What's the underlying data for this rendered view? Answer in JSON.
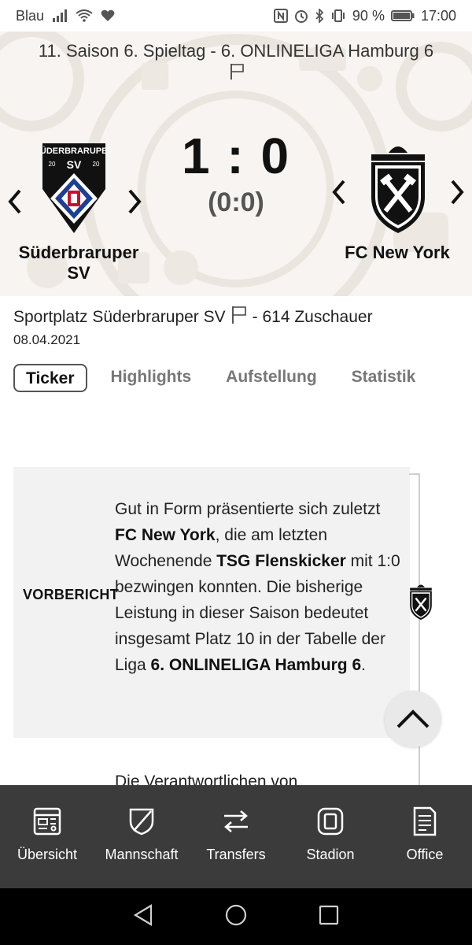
{
  "status_bar": {
    "carrier": "Blau",
    "battery": "90 %",
    "time": "17:00"
  },
  "match": {
    "league": "11. Saison 6. Spieltag - 6. ONLINELIGA Hamburg 6",
    "score": "1 : 0",
    "halftime": "(0:0)",
    "home": {
      "name": "Süderbraruper SV",
      "crest_top_text": "SÜDERBRARUPER",
      "crest_year_left": "20",
      "crest_abbr": "SV",
      "crest_year_right": "20"
    },
    "away": {
      "name": "FC New York"
    },
    "venue": "Sportplatz Süderbraruper SV",
    "spectators": "- 614 Zuschauer",
    "date": "08.04.2021"
  },
  "tabs": [
    {
      "label": "Ticker",
      "active": true
    },
    {
      "label": "Highlights",
      "active": false
    },
    {
      "label": "Aufstellung",
      "active": false
    },
    {
      "label": "Statistik",
      "active": false
    }
  ],
  "ticker": {
    "label": "VORBERICHT",
    "text": {
      "p1": "Gut in Form präsentierte sich zuletzt ",
      "b1": "FC New York",
      "p2": ", die am letzten Wochenende ",
      "b2": "TSG Flenskicker",
      "p3": " mit 1:0 bezwingen konnten. Die bisherige Leistung in dieser Saison bedeutet insgesamt Platz 10 in der Tabelle der Liga ",
      "b3": "6. ONLINELIGA Hamburg 6",
      "p4": "."
    },
    "next_text": "Die Verantwortlichen von"
  },
  "bottom_nav": [
    {
      "label": "Übersicht",
      "icon": "overview-icon"
    },
    {
      "label": "Mannschaft",
      "icon": "shield-icon"
    },
    {
      "label": "Transfers",
      "icon": "transfer-arrows-icon"
    },
    {
      "label": "Stadion",
      "icon": "stadium-icon"
    },
    {
      "label": "Office",
      "icon": "document-icon"
    }
  ],
  "colors": {
    "bottom_nav_bg": "#3b3b3b",
    "header_bg": "#f7f4f1",
    "card_bg": "#f2f2f2",
    "crest_blue": "#1a3f93"
  }
}
